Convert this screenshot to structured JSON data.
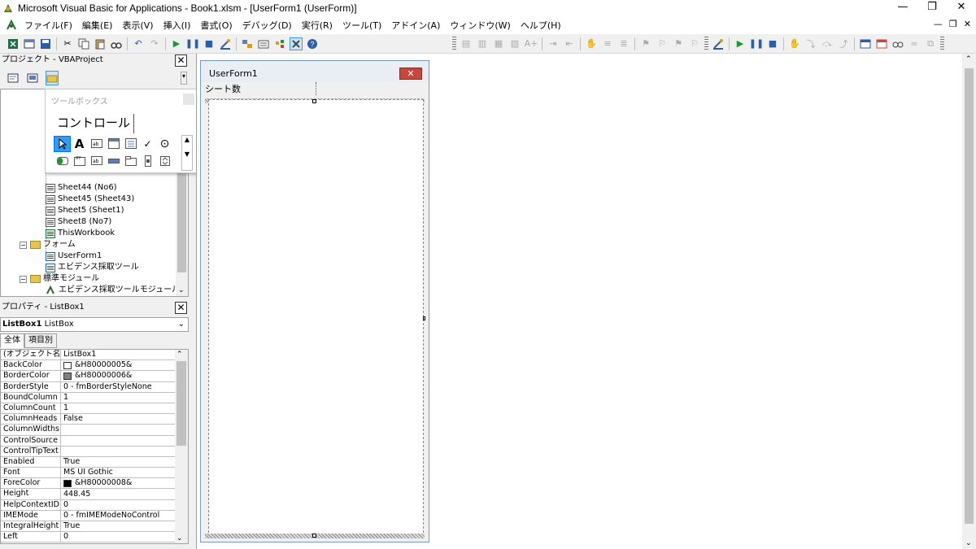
{
  "window": {
    "title": "Microsoft Visual Basic for Applications - Book1.xlsm - [UserForm1 (UserForm)]",
    "controls": [
      "—",
      "❐",
      "✕"
    ]
  },
  "menu": {
    "items": [
      "ファイル(F)",
      "編集(E)",
      "表示(V)",
      "挿入(I)",
      "書式(O)",
      "デバッグ(D)",
      "実行(R)",
      "ツール(T)",
      "アドイン(A)",
      "ウィンドウ(W)",
      "ヘルプ(H)"
    ],
    "mdi_controls": [
      "—",
      "❐",
      "✕"
    ]
  },
  "project": {
    "header": "プロジェクト - VBAProject",
    "close": "✕",
    "tree": [
      {
        "label": "Sheet44 (No6)",
        "type": "sheet"
      },
      {
        "label": "Sheet45 (Sheet43)",
        "type": "sheet"
      },
      {
        "label": "Sheet5 (Sheet1)",
        "type": "sheet"
      },
      {
        "label": "Sheet8 (No7)",
        "type": "sheet"
      },
      {
        "label": "ThisWorkbook",
        "type": "workbook"
      },
      {
        "label": "フォーム",
        "type": "folder"
      },
      {
        "label": "UserForm1",
        "type": "form"
      },
      {
        "label": "エビデンス採取ツール",
        "type": "form"
      },
      {
        "label": "標準モジュール",
        "type": "folder"
      },
      {
        "label": "エビデンス採取ツールモジュール",
        "type": "module"
      }
    ]
  },
  "toolbox": {
    "title": "ツールボックス",
    "tab": "コントロール",
    "row1": [
      "pointer-icon",
      "label-icon",
      "textbox-icon",
      "combobox-icon",
      "listbox-icon",
      "checkbox-icon",
      "optionbutton-icon"
    ],
    "row2": [
      "togglebutton-icon",
      "frame-icon",
      "commandbutton-icon",
      "tabstrip-icon",
      "multipage-icon",
      "scrollbar-icon",
      "spinbutton-icon"
    ],
    "label_glyph": "A",
    "checkbox_glyph": "✓",
    "option_glyph": "⊙"
  },
  "properties": {
    "header": "プロパティ - ListBox1",
    "close": "✕",
    "object": "ListBox1",
    "object_type": "ListBox",
    "tabs": [
      "全体",
      "項目別"
    ],
    "rows": [
      {
        "name": "(オブジェクト名)",
        "value": "ListBox1"
      },
      {
        "name": "BackColor",
        "value": "&H80000005&",
        "swatch": "#ffffff"
      },
      {
        "name": "BorderColor",
        "value": "&H80000006&",
        "swatch": "#808080"
      },
      {
        "name": "BorderStyle",
        "value": "0 - fmBorderStyleNone"
      },
      {
        "name": "BoundColumn",
        "value": "1"
      },
      {
        "name": "ColumnCount",
        "value": "1"
      },
      {
        "name": "ColumnHeads",
        "value": "False"
      },
      {
        "name": "ColumnWidths",
        "value": ""
      },
      {
        "name": "ControlSource",
        "value": ""
      },
      {
        "name": "ControlTipText",
        "value": ""
      },
      {
        "name": "Enabled",
        "value": "True"
      },
      {
        "name": "Font",
        "value": "MS UI Gothic"
      },
      {
        "name": "ForeColor",
        "value": "&H80000008&",
        "swatch": "#000000"
      },
      {
        "name": "Height",
        "value": "448.45"
      },
      {
        "name": "HelpContextID",
        "value": "0"
      },
      {
        "name": "IMEMode",
        "value": "0 - fmIMEModeNoControl"
      },
      {
        "name": "IntegralHeight",
        "value": "True"
      },
      {
        "name": "Left",
        "value": "0"
      }
    ]
  },
  "userform": {
    "title": "UserForm1",
    "close": "✕",
    "label": "シート数"
  },
  "colors": {
    "accent": "#3399ff",
    "close_red": "#c8473b"
  }
}
